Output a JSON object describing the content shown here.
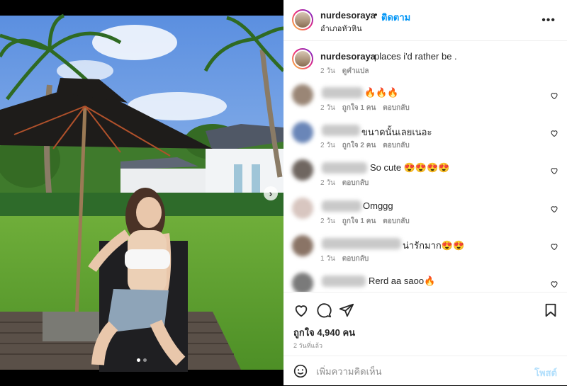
{
  "post": {
    "username": "nurdesoraya",
    "dot": "•",
    "follow_label": "ติดตาม",
    "location": "อำเภอหัวหิน",
    "more_label": "•••"
  },
  "caption": {
    "username": "nurdesoraya",
    "text": "places i'd rather be .",
    "age": "2 วัน",
    "translate_label": "ดูคำแปล"
  },
  "comments": [
    {
      "text": "🔥🔥🔥",
      "age": "2 วัน",
      "likes": "ถูกใจ 1 คน",
      "reply": "ตอบกลับ"
    },
    {
      "text": "ขนาดนั้นเลยเนอะ",
      "age": "2 วัน",
      "likes": "ถูกใจ 2 คน",
      "reply": "ตอบกลับ"
    },
    {
      "text": "So cute 😍😍😍😍",
      "age": "2 วัน",
      "likes": "",
      "reply": "ตอบกลับ"
    },
    {
      "text": "Omggg",
      "age": "2 วัน",
      "likes": "ถูกใจ 1 คน",
      "reply": "ตอบกลับ"
    },
    {
      "text": "น่ารักมาก😍😍",
      "age": "1 วัน",
      "likes": "",
      "reply": "ตอบกลับ"
    },
    {
      "text": "Rerd aa saoo🔥",
      "age": "",
      "likes": "",
      "reply": ""
    }
  ],
  "stats": {
    "likes": "ถูกใจ 4,940 คน",
    "time": "2 วันที่แล้ว"
  },
  "add_comment": {
    "placeholder": "เพิ่มความคิดเห็น",
    "post_label": "โพสต์"
  },
  "carousel": {
    "next": "›",
    "count": 2,
    "active": 0
  },
  "colors": {
    "accent": "#0095f6",
    "text": "#262626",
    "muted": "#8e8e8e"
  }
}
